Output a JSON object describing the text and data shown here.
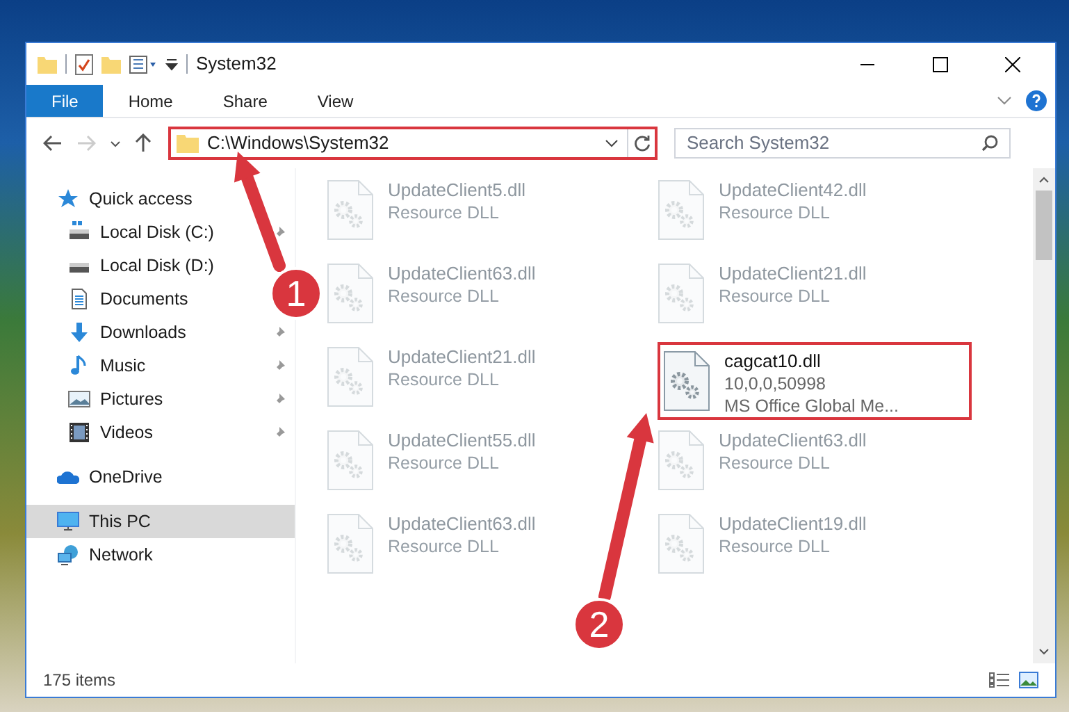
{
  "window": {
    "title": "System32"
  },
  "ribbon_tabs": [
    {
      "label": "File",
      "selected": true
    },
    {
      "label": "Home",
      "selected": false
    },
    {
      "label": "Share",
      "selected": false
    },
    {
      "label": "View",
      "selected": false
    }
  ],
  "address_bar": {
    "path": "C:\\Windows\\System32"
  },
  "search": {
    "placeholder": "Search System32"
  },
  "sidebar": {
    "items": [
      {
        "label": "Quick access",
        "selected": false,
        "children": [
          {
            "label": "Local Disk (C:)",
            "pinned": true,
            "selected": false
          },
          {
            "label": "Local Disk (D:)",
            "pinned": false,
            "selected": false
          },
          {
            "label": "Documents",
            "pinned": false,
            "selected": false
          },
          {
            "label": "Downloads",
            "pinned": true,
            "selected": false
          },
          {
            "label": "Music",
            "pinned": true,
            "selected": false
          },
          {
            "label": "Pictures",
            "pinned": true,
            "selected": false
          },
          {
            "label": "Videos",
            "pinned": true,
            "selected": false
          }
        ]
      },
      {
        "label": "OneDrive",
        "selected": false
      },
      {
        "label": "This PC",
        "selected": true
      },
      {
        "label": "Network",
        "selected": false
      }
    ]
  },
  "files": [
    {
      "name": "UpdateClient5.dll",
      "lines": [
        "Resource DLL"
      ],
      "kind": "dimmed"
    },
    {
      "name": "UpdateClient42.dll",
      "lines": [
        "Resource DLL"
      ],
      "kind": "dimmed"
    },
    {
      "name": "UpdateClient63.dll",
      "lines": [
        "Resource DLL"
      ],
      "kind": "dimmed"
    },
    {
      "name": "UpdateClient21.dll",
      "lines": [
        "Resource DLL"
      ],
      "kind": "dimmed"
    },
    {
      "name": "UpdateClient21.dll",
      "lines": [
        "Resource DLL"
      ],
      "kind": "dimmed"
    },
    {
      "name": "cagcat10.dll",
      "lines": [
        "10,0,0,50998",
        "MS Office Global Me..."
      ],
      "kind": "highlighted"
    },
    {
      "name": "UpdateClient55.dll",
      "lines": [
        "Resource DLL"
      ],
      "kind": "dimmed"
    },
    {
      "name": "UpdateClient63.dll",
      "lines": [
        "Resource DLL"
      ],
      "kind": "dimmed"
    },
    {
      "name": "UpdateClient63.dll",
      "lines": [
        "Resource DLL"
      ],
      "kind": "dimmed"
    },
    {
      "name": "UpdateClient19.dll",
      "lines": [
        "Resource DLL"
      ],
      "kind": "dimmed"
    }
  ],
  "status_bar": {
    "item_count": "175 items"
  },
  "annotations": [
    {
      "label": "1"
    },
    {
      "label": "2"
    }
  ]
}
